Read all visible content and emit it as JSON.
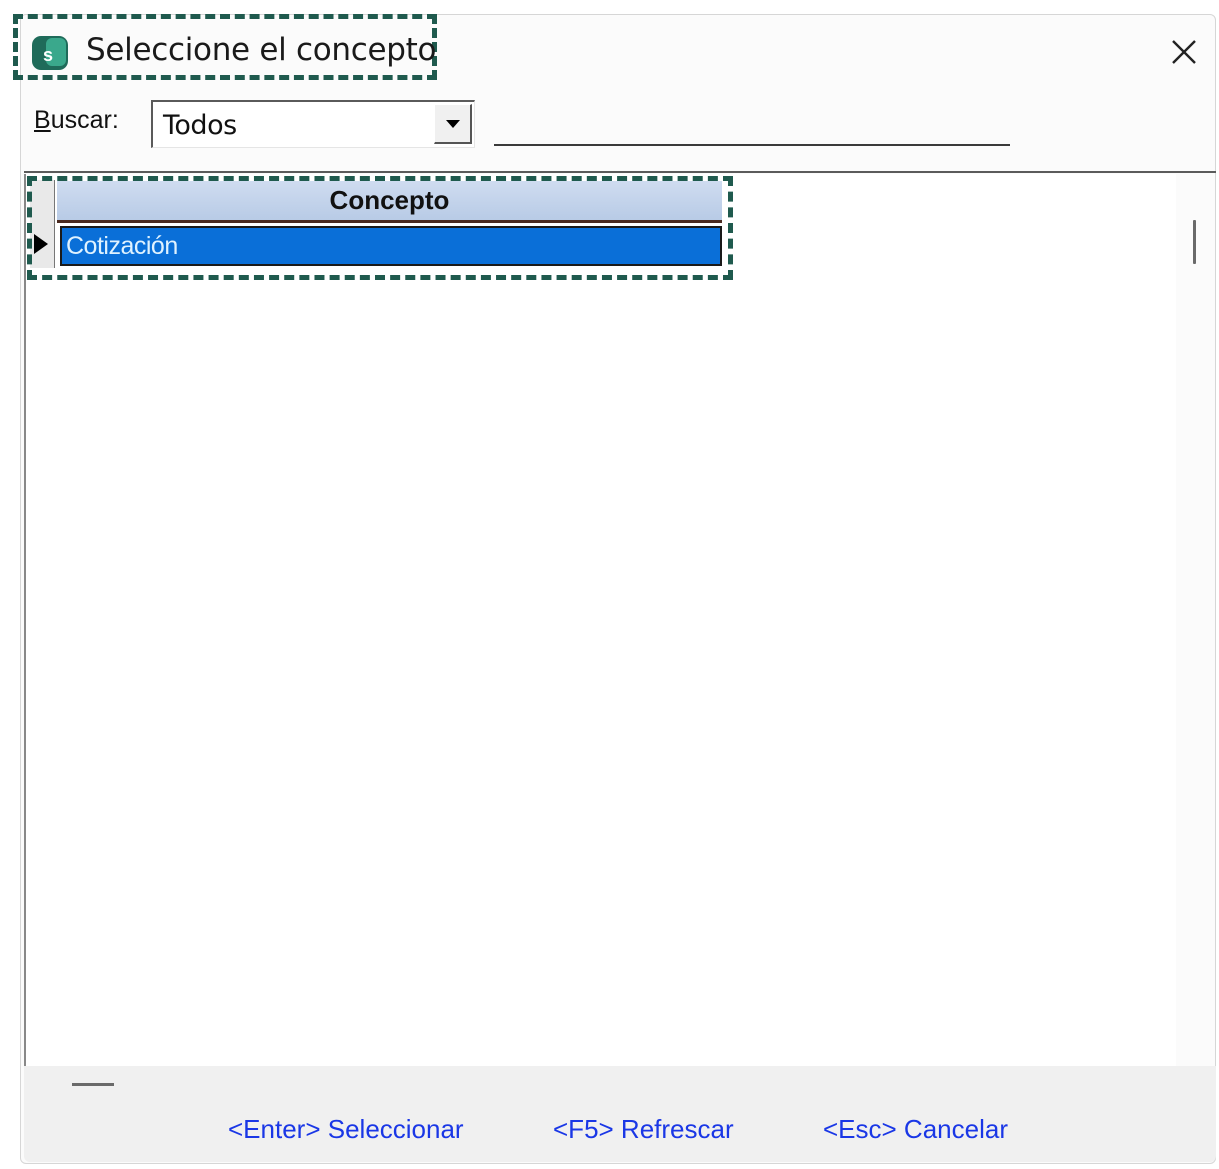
{
  "window": {
    "title": "Seleccione el concepto"
  },
  "search": {
    "label_mnemonic": "B",
    "label_rest": "uscar:",
    "filter_value": "Todos",
    "text_value": ""
  },
  "grid": {
    "columns": [
      "Concepto"
    ],
    "rows": [
      {
        "concepto": "Cotización",
        "selected": true
      }
    ]
  },
  "footer": {
    "select_label": "<Enter> Seleccionar",
    "refresh_label": "<F5> Refrescar",
    "cancel_label": "<Esc> Cancelar"
  },
  "colors": {
    "highlight_border": "#1f5a4e",
    "selection": "#0a6fd8",
    "link": "#1a37e6",
    "header_bg": "#c4d4ec"
  },
  "icons": {
    "app": "app-s-icon",
    "close": "close-icon",
    "dropdown": "chevron-down-icon",
    "row_pointer": "row-pointer-icon"
  }
}
